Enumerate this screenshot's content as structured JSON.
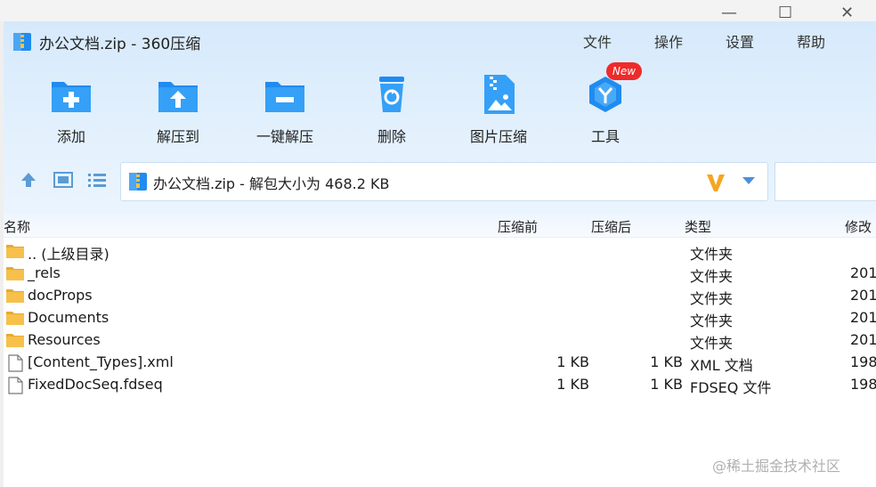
{
  "window": {
    "title": "办公文档.zip - 360压缩",
    "controls": {
      "minimize": "—",
      "maximize": "☐",
      "close": "✕"
    }
  },
  "menu": [
    "文件",
    "操作",
    "设置",
    "帮助"
  ],
  "toolbar": [
    {
      "label": "添加",
      "icon": "add-icon"
    },
    {
      "label": "解压到",
      "icon": "extract-to-icon"
    },
    {
      "label": "一键解压",
      "icon": "one-click-extract-icon"
    },
    {
      "label": "删除",
      "icon": "delete-icon"
    },
    {
      "label": "图片压缩",
      "icon": "image-compress-icon"
    },
    {
      "label": "工具",
      "icon": "tools-icon",
      "badge": "New"
    }
  ],
  "pathbar": {
    "text": "办公文档.zip - 解包大小为 468.2 KB",
    "search_placeholder": ""
  },
  "columns": {
    "name": "名称",
    "compressed": "压缩前",
    "original": "压缩后",
    "type": "类型",
    "modified": "修改"
  },
  "files": [
    {
      "name": ".. (上级目录)",
      "compressed": "",
      "original": "",
      "type": "文件夹",
      "modified": "",
      "kind": "folder"
    },
    {
      "name": "_rels",
      "compressed": "",
      "original": "",
      "type": "文件夹",
      "modified": "201",
      "kind": "folder"
    },
    {
      "name": "docProps",
      "compressed": "",
      "original": "",
      "type": "文件夹",
      "modified": "201",
      "kind": "folder"
    },
    {
      "name": "Documents",
      "compressed": "",
      "original": "",
      "type": "文件夹",
      "modified": "201",
      "kind": "folder"
    },
    {
      "name": "Resources",
      "compressed": "",
      "original": "",
      "type": "文件夹",
      "modified": "201",
      "kind": "folder"
    },
    {
      "name": "[Content_Types].xml",
      "compressed": "1 KB",
      "original": "1 KB",
      "type": "XML 文档",
      "modified": "198",
      "kind": "file"
    },
    {
      "name": "FixedDocSeq.fdseq",
      "compressed": "1 KB",
      "original": "1 KB",
      "type": "FDSEQ 文件",
      "modified": "198",
      "kind": "file"
    }
  ],
  "watermark": "@稀土掘金技术社区",
  "colors": {
    "accent": "#1f8cf0",
    "header_bg": "#d6e9fb",
    "badge": "#ef2a2a",
    "folder": "#f6c04a"
  }
}
